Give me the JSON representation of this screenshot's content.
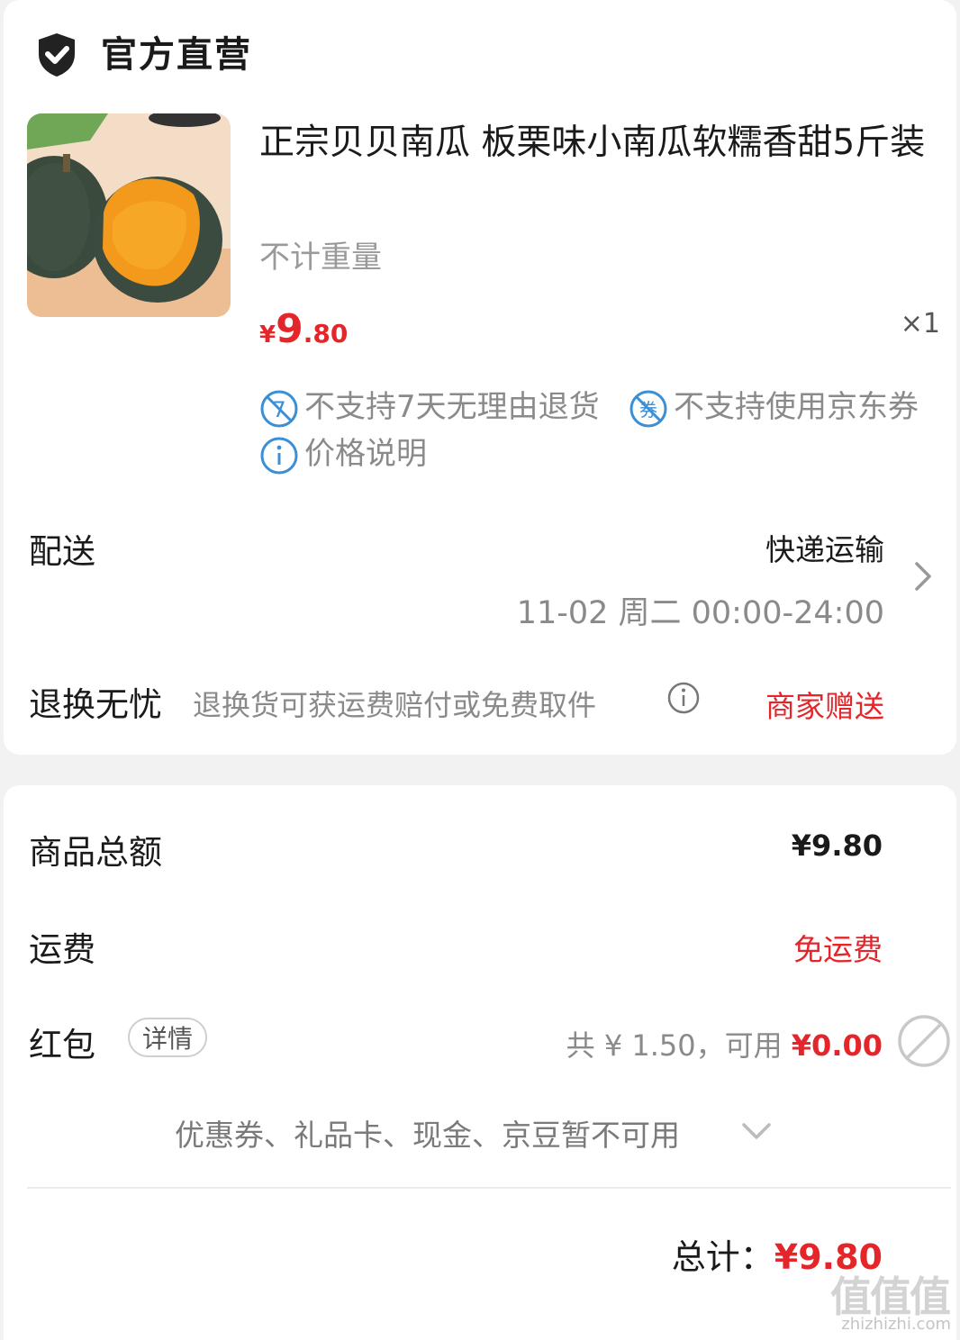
{
  "header": {
    "title": "官方直营",
    "icon": "shield-check-icon"
  },
  "product": {
    "name": "正宗贝贝南瓜 板栗味小南瓜软糯香甜5斤装",
    "spec": "不计重量",
    "price_symbol": "¥",
    "price_int": "9",
    "price_dec": ".80",
    "quantity": "×1",
    "tags": {
      "no_return": "不支持7天无理由退货",
      "no_coupon": "不支持使用京东券",
      "price_info": "价格说明"
    }
  },
  "delivery": {
    "label": "配送",
    "method": "快递运输",
    "time": "11-02 周二 00:00-24:00"
  },
  "return_service": {
    "label": "退换无忧",
    "desc": "退换货可获运费赔付或免费取件",
    "value": "商家赠送"
  },
  "summary": {
    "goods_total_label": "商品总额",
    "goods_total_value": "¥9.80",
    "shipping_label": "运费",
    "shipping_value": "免运费",
    "redpacket_label": "红包",
    "redpacket_detail": "详情",
    "redpacket_total": "共 ¥ 1.50，可用",
    "redpacket_avail": "¥0.00",
    "unavailable_note": "优惠券、礼品卡、现金、京豆暂不可用",
    "total_label": "总计：",
    "total_value": "¥9.80"
  },
  "watermark": {
    "logo": "值值值",
    "url": "zhizhizhi.com"
  },
  "colors": {
    "accent_red": "#e4262b",
    "info_blue": "#3a8fd6",
    "grey_text": "#8a8a8a"
  }
}
